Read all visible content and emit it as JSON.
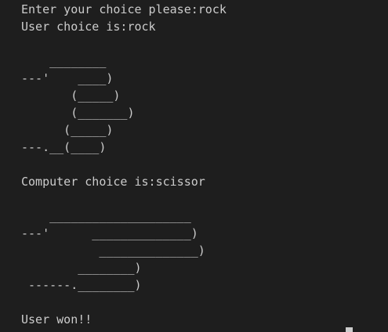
{
  "terminal": {
    "prompt_line": "Enter your choice please:rock",
    "user_choice_line": "User choice is:rock",
    "rock_art": [
      "",
      "    ________",
      "---'    ____)",
      "       (_____)",
      "       (_______)",
      "      (_____)",
      "---.__(____)"
    ],
    "computer_choice_line": "Computer choice is:scissor",
    "scissor_art": [
      "",
      "    ____________________",
      "---'      ______________)",
      "           ______________)",
      "        ________)",
      " ------.________)"
    ],
    "result_line": "User won!!"
  },
  "colors": {
    "background": "#1e1e1e",
    "text": "#cccccc"
  }
}
